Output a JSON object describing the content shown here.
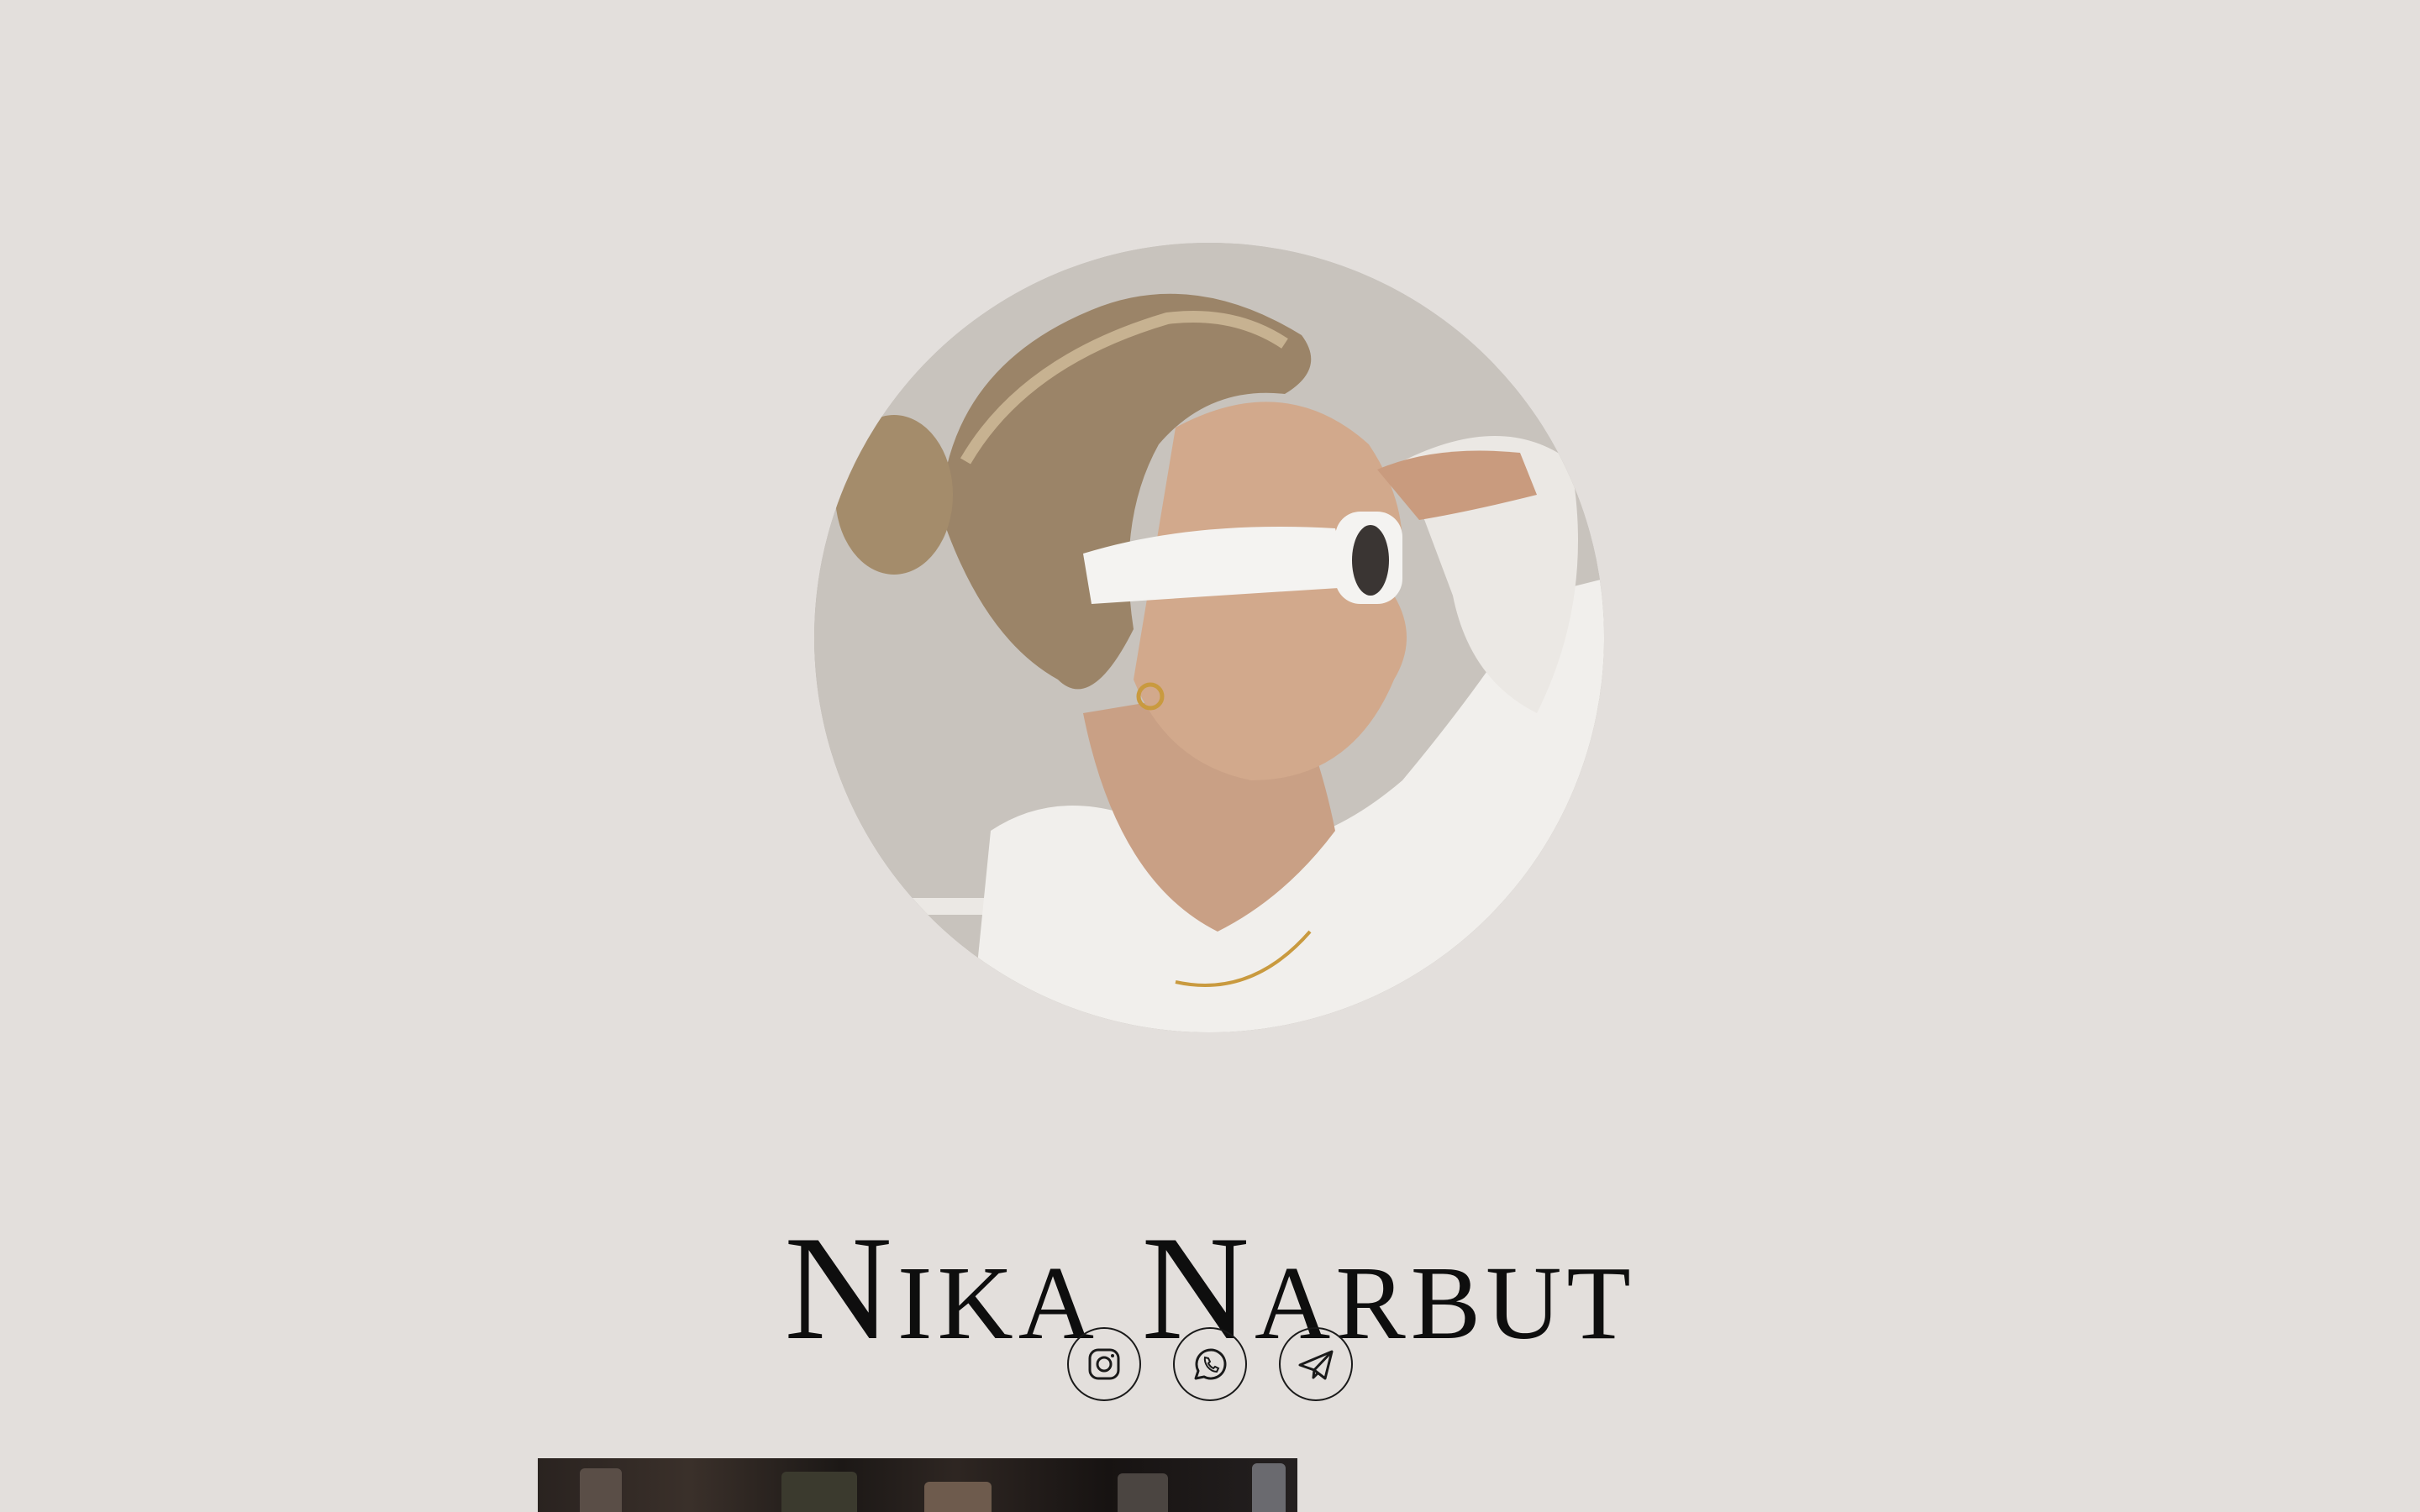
{
  "profile": {
    "name": "Nika Narbut",
    "avatar_icon": "portrait-photo"
  },
  "socials": [
    {
      "id": "instagram",
      "icon": "instagram-icon"
    },
    {
      "id": "whatsapp",
      "icon": "whatsapp-icon"
    },
    {
      "id": "telegram",
      "icon": "telegram-icon"
    }
  ],
  "colors": {
    "background": "#e3dfdc",
    "text": "#0e0e0e",
    "icon_stroke": "#1a1a1a"
  }
}
